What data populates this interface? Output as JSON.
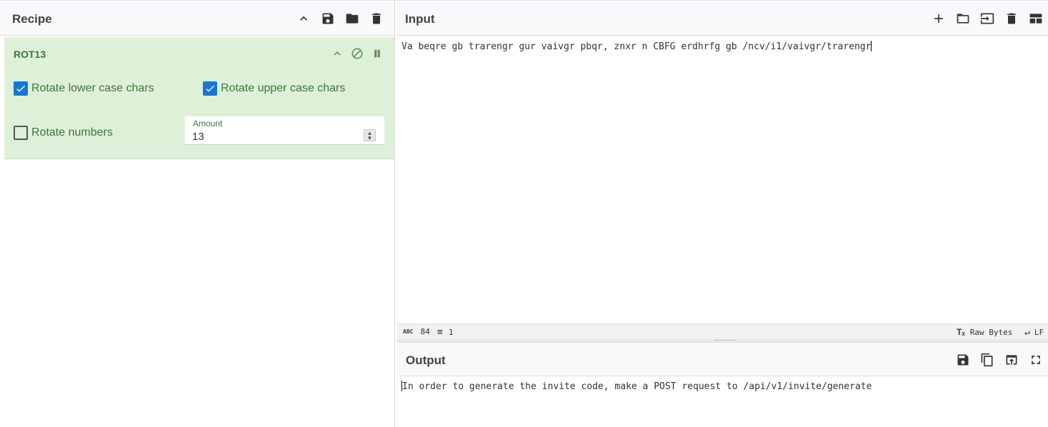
{
  "recipe": {
    "title": "Recipe",
    "operation": {
      "name": "ROT13",
      "rotate_lower_label": "Rotate lower case chars",
      "rotate_lower_checked": true,
      "rotate_upper_label": "Rotate upper case chars",
      "rotate_upper_checked": true,
      "rotate_numbers_label": "Rotate numbers",
      "rotate_numbers_checked": false,
      "amount_label": "Amount",
      "amount_value": "13"
    }
  },
  "input": {
    "title": "Input",
    "text": "Va beqre gb trarengr gur vaivgr pbqr, znxr n CBFG erdhrfg gb /ncv/i1/vaivgr/trarengr",
    "status": {
      "length": "84",
      "lines": "1",
      "encoding": "Raw Bytes",
      "eol": "LF"
    }
  },
  "output": {
    "title": "Output",
    "text": "In order to generate the invite code, make a POST request to /api/v1/invite/generate"
  },
  "colors": {
    "accent_blue": "#1976d2",
    "op_background": "#dff0d8",
    "op_text": "#3c763d"
  }
}
